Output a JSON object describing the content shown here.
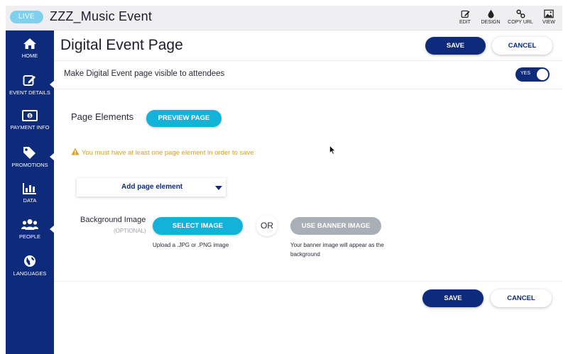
{
  "topbar": {
    "live_badge": "LIVE",
    "event_title": "ZZZ_Music Event",
    "actions": [
      {
        "label": "EDIT",
        "icon": "edit-icon"
      },
      {
        "label": "DESIGN",
        "icon": "droplet-icon"
      },
      {
        "label": "COPY URL",
        "icon": "link-icon"
      },
      {
        "label": "VIEW",
        "icon": "image-icon"
      }
    ]
  },
  "sidebar": {
    "items": [
      {
        "label": "HOME",
        "icon": "home-icon"
      },
      {
        "label": "EVENT DETAILS",
        "icon": "edit-icon",
        "active": true
      },
      {
        "label": "PAYMENT INFO",
        "icon": "money-icon"
      },
      {
        "label": "PROMOTIONS",
        "icon": "tag-icon",
        "active": true
      },
      {
        "label": "DATA",
        "icon": "bar-chart-icon"
      },
      {
        "label": "PEOPLE",
        "icon": "people-icon",
        "active": true
      },
      {
        "label": "LANGUAGES",
        "icon": "globe-icon"
      }
    ]
  },
  "main": {
    "title": "Digital Event Page",
    "save_label": "SAVE",
    "cancel_label": "CANCEL",
    "visible_label": "Make Digital Event page visible to attendees",
    "toggle_label": "YES",
    "page_elements_label": "Page Elements",
    "preview_label": "PREVIEW PAGE",
    "warning_text": "You must have at least one page element in order to save",
    "add_element_label": "Add page element",
    "background_label": "Background Image",
    "optional_label": "(OPTIONAL)",
    "select_image_label": "SELECT IMAGE",
    "select_image_help": "Upload a .JPG or .PNG image",
    "or_label": "OR",
    "banner_label": "USE BANNER IMAGE",
    "banner_help_1": "Your banner image will appear as the",
    "banner_help_2": "background",
    "bottom_save_label": "SAVE",
    "bottom_cancel_label": "CANCEL"
  },
  "colors": {
    "navy": "#0e2a7b",
    "cyan": "#13b2d8",
    "live": "#7fd0ea",
    "warning": "#d9a020",
    "disabled": "#a8afb6"
  }
}
